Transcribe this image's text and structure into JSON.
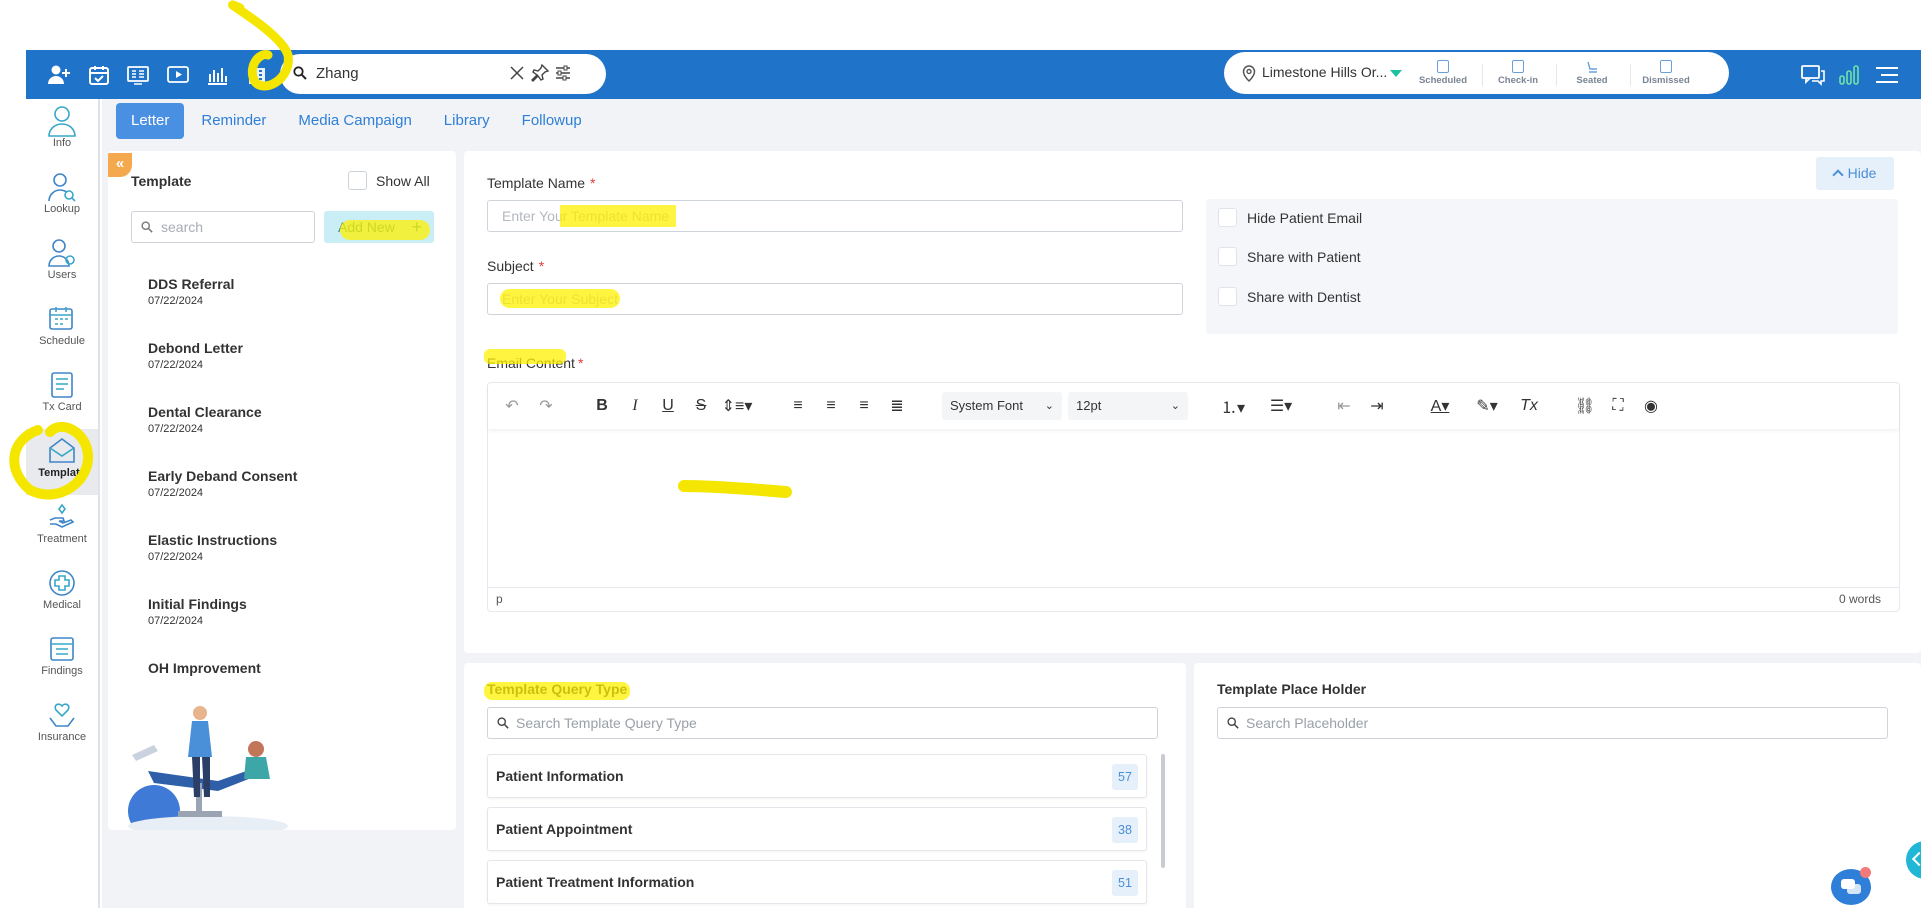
{
  "topbar": {
    "search_value": "Zhang",
    "location": "Limestone Hills Or...",
    "statuses": [
      "Scheduled",
      "Check-in",
      "Seated",
      "Dismissed"
    ],
    "icons": [
      "add-user-icon",
      "calendar-check-icon",
      "monitor-grid-icon",
      "play-screen-icon",
      "bar-chart-icon",
      "building-icon"
    ],
    "right_icons": [
      "chat-icon",
      "signal-bars-icon",
      "menu-icon"
    ]
  },
  "sidebar": {
    "items": [
      {
        "label": "Info",
        "icon": "user-icon"
      },
      {
        "label": "Lookup",
        "icon": "user-search-icon"
      },
      {
        "label": "Users",
        "icon": "users-icon"
      },
      {
        "label": "Schedule",
        "icon": "calendar-icon"
      },
      {
        "label": "Tx Card",
        "icon": "card-icon"
      },
      {
        "label": "Template",
        "icon": "envelope-open-icon",
        "active": true
      },
      {
        "label": "Treatment",
        "icon": "hand-tooth-icon"
      },
      {
        "label": "Medical",
        "icon": "medical-cross-icon"
      },
      {
        "label": "Findings",
        "icon": "clipboard-icon"
      },
      {
        "label": "Insurance",
        "icon": "insurance-hands-icon"
      }
    ]
  },
  "tabs": [
    {
      "label": "Letter",
      "active": true
    },
    {
      "label": "Reminder"
    },
    {
      "label": "Media Campaign"
    },
    {
      "label": "Library"
    },
    {
      "label": "Followup"
    }
  ],
  "templates": {
    "title": "Template",
    "show_all": "Show All",
    "search_placeholder": "search",
    "add_new": "Add New",
    "items": [
      {
        "name": "DDS Referral",
        "date": "07/22/2024"
      },
      {
        "name": "Debond Letter",
        "date": "07/22/2024"
      },
      {
        "name": "Dental Clearance",
        "date": "07/22/2024"
      },
      {
        "name": "Early Deband Consent",
        "date": "07/22/2024"
      },
      {
        "name": "Elastic Instructions",
        "date": "07/22/2024"
      },
      {
        "name": "Initial Findings",
        "date": "07/22/2024"
      },
      {
        "name": "OH Improvement",
        "date": ""
      }
    ]
  },
  "form": {
    "hide_button": "Hide",
    "template_name_label": "Template Name",
    "template_name_placeholder": "Enter Your Template Name",
    "subject_label": "Subject",
    "subject_placeholder": "Enter Your Subject",
    "required_mark": "*",
    "checks": [
      "Hide Patient Email",
      "Share with Patient",
      "Share with Dentist"
    ],
    "email_content_label": "Email Content",
    "font_family": "System Font",
    "font_size": "12pt",
    "path": "p",
    "word_count": "0 words"
  },
  "query": {
    "title": "Template Query Type",
    "search_placeholder": "Search Template Query Type",
    "rows": [
      {
        "label": "Patient Information",
        "count": "57"
      },
      {
        "label": "Patient Appointment",
        "count": "38"
      },
      {
        "label": "Patient Treatment Information",
        "count": "51"
      }
    ]
  },
  "placeholder": {
    "title": "Template Place Holder",
    "search_placeholder": "Search Placeholder"
  },
  "colors": {
    "topbar": "#1f73c8",
    "accent": "#4a90e2",
    "highlight": "#fff000",
    "required": "#e23b3b",
    "add_new_bg": "#c9eef5"
  }
}
